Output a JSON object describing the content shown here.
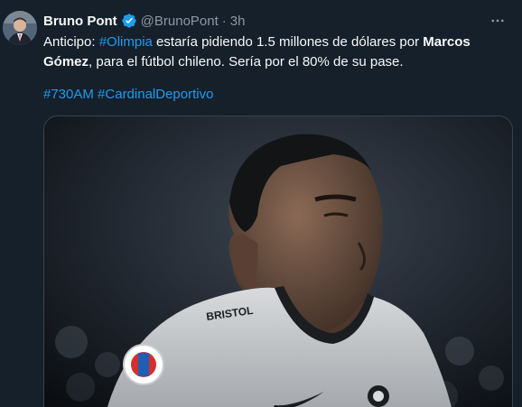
{
  "tweet": {
    "author_name": "Bruno Pont",
    "handle": "@BrunoPont",
    "separator": "·",
    "time": "3h",
    "text": {
      "part1": "Anticipo: ",
      "hashtag1": "#Olimpia",
      "part2": " estaría pidiendo 1.5 millones de dólares por ",
      "bold_name": "Marcos Gómez",
      "part3": ", para el fútbol chileno. Sería por el 80% de su pase."
    },
    "hashtags": [
      "#730AM",
      "#CardinalDeportivo"
    ],
    "media": {
      "jersey_sponsor": "BRISTOL",
      "icon": "photo-player"
    }
  },
  "colors": {
    "background": "#15202b",
    "text": "#f7f9f9",
    "muted": "#8b98a5",
    "link": "#1d9bf0",
    "verified": "#1d9bf0"
  },
  "icons": {
    "verified": "verified-badge-icon",
    "more": "more-dots-icon"
  }
}
